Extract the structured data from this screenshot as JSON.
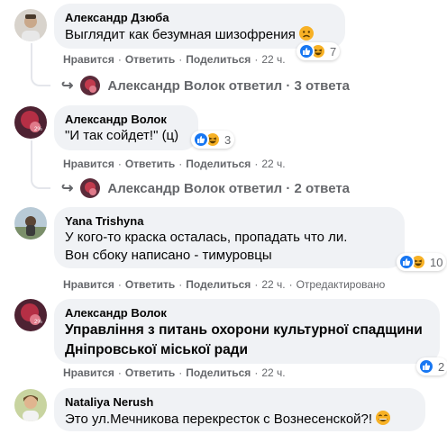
{
  "actions": {
    "like": "Нравится",
    "reply": "Ответить",
    "share": "Поделиться",
    "dot": "·"
  },
  "comments": [
    {
      "author": "Александр Дзюба",
      "text": "Выглядит как безумная шизофрения",
      "reactions_count": "7",
      "time": "22 ч.",
      "replies_label": "Александр Волок ответил · 3 ответа"
    },
    {
      "author": "Александр Волок",
      "text": "\"И так сойдет!\" (ц)",
      "reactions_count": "3",
      "time": "22 ч.",
      "replies_label": "Александр Волок ответил · 2 ответа"
    },
    {
      "author": "Yana Trishyna",
      "text_line1": "У кого-то краска осталась, пропадать что ли.",
      "text_line2": "Вон сбоку написано - тимуровцы",
      "reactions_count": "10",
      "time": "22 ч.",
      "edited": "Отредактировано"
    },
    {
      "author": "Александр Волок",
      "text_line1": "Управління з питань охорони культурної спадщини",
      "text_line2": "Дніпровської міської ради",
      "reactions_count": "2",
      "time": "22 ч."
    },
    {
      "author": "Nataliya Nerush",
      "text": "Это ул.Мечникова перекресток с Вознесенской?!"
    }
  ],
  "icons": {
    "like": "thumbs-up-icon",
    "haha": "laughing-face-icon",
    "sad": "sad-face-icon",
    "reply": "reply-arrow-icon",
    "grin": "grinning-face-icon"
  },
  "colors": {
    "bubble": "#f0f2f5",
    "muted_text": "#65676b",
    "like_blue": "#1877f2",
    "emoji_yellow": "#f7b125"
  }
}
